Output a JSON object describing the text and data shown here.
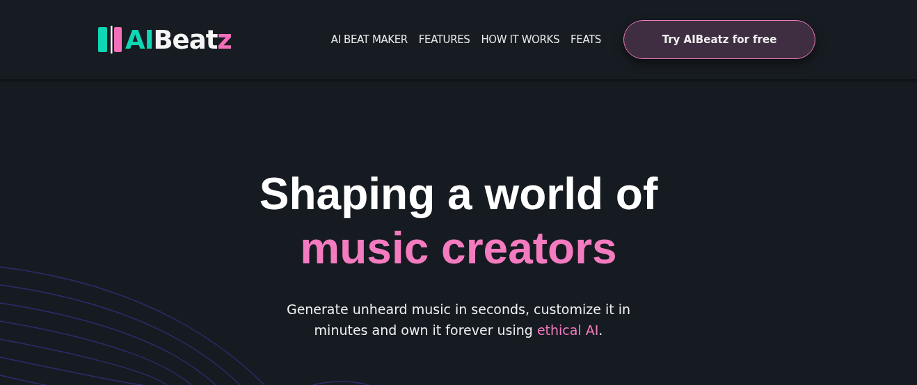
{
  "logo": {
    "parts": [
      {
        "text": "AI",
        "color": "#0fd6b4"
      },
      {
        "text": "Beat",
        "color": "#f5f5f5"
      },
      {
        "text": "z",
        "color": "#f46fb9"
      }
    ]
  },
  "nav": {
    "links": [
      "AI BEAT MAKER",
      "FEATURES",
      "HOW IT WORKS",
      "FEATS"
    ],
    "cta": "Try AIBeatz for free"
  },
  "hero": {
    "title_lines": [
      {
        "text": "Shaping a world of",
        "color": "#ffffff"
      },
      {
        "text": "music creators",
        "color": "#f47bbf"
      }
    ],
    "subtitle": {
      "text": "Generate unheard music in seconds, customize it in minutes and own it forever using ",
      "link": "ethical AI",
      "end": "."
    }
  }
}
